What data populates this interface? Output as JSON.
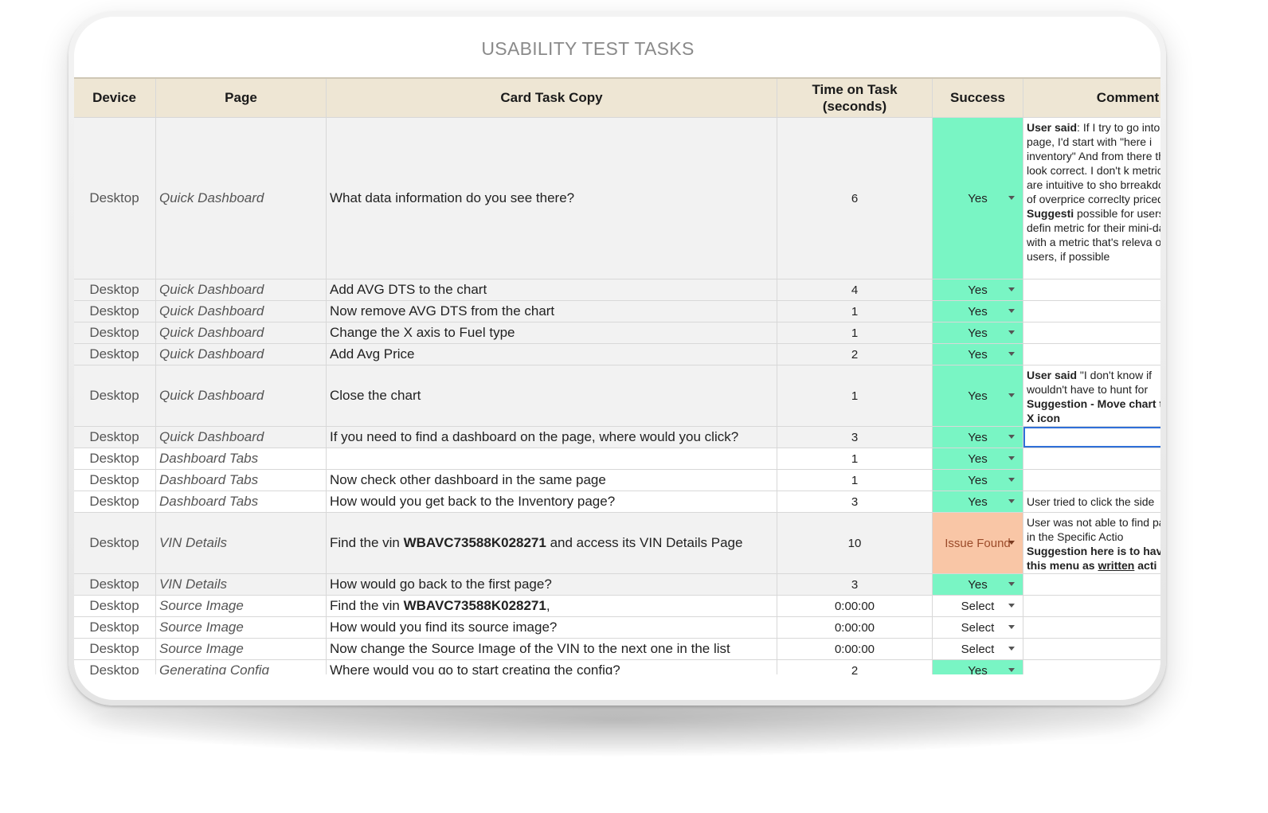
{
  "title": "USABILITY TEST TASKS",
  "columns": {
    "device": "Device",
    "page": "Page",
    "task": "Card Task Copy",
    "time": "Time on Task (seconds)",
    "success": "Success",
    "comments": "Comment"
  },
  "rows": [
    {
      "device": "Desktop",
      "page": "Quick Dashboard",
      "task": "What data information do you see there?",
      "time": "6",
      "success": "Yes",
      "comment_html": "<b>User said</b>: If I try to go into page, I'd start with \"here i inventory\"  And from there they look correct. I don't k metrics are intuitive to sho brreakdowns of overprice correclty priced. <b>Suggesti</b> possible for users to defin metric for their mini-dashb with a metric that's releva of users, if possible"
    },
    {
      "device": "Desktop",
      "page": "Quick Dashboard",
      "task": "Add AVG DTS to the chart",
      "time": "4",
      "success": "Yes",
      "comment_html": ""
    },
    {
      "device": "Desktop",
      "page": "Quick Dashboard",
      "task": "Now remove AVG DTS from the chart",
      "time": "1",
      "success": "Yes",
      "comment_html": ""
    },
    {
      "device": "Desktop",
      "page": "Quick Dashboard",
      "task": "Change the X axis to Fuel type",
      "time": "1",
      "success": "Yes",
      "comment_html": ""
    },
    {
      "device": "Desktop",
      "page": "Quick Dashboard",
      "task": "Add Avg Price",
      "time": "2",
      "success": "Yes",
      "comment_html": ""
    },
    {
      "device": "Desktop",
      "page": "Quick Dashboard",
      "task": "Close the chart",
      "time": "1",
      "success": "Yes",
      "comment_html": "<b>User said</b> \"I don't know if wouldn't have to hunt for <b>Suggestion - Move chart the X icon</b>"
    },
    {
      "device": "Desktop",
      "page": "Quick Dashboard",
      "task": "If you need to find a dashboard on the page, where would you click?",
      "time": "3",
      "success": "Yes",
      "comment_html": ""
    },
    {
      "device": "Desktop",
      "page": "Dashboard Tabs",
      "task": "",
      "time": "1",
      "success": "Yes",
      "comment_html": ""
    },
    {
      "device": "Desktop",
      "page": "Dashboard Tabs",
      "task": "Now check other dashboard in the same page",
      "time": "1",
      "success": "Yes",
      "comment_html": ""
    },
    {
      "device": "Desktop",
      "page": "Dashboard Tabs",
      "task": "How would you get back to the Inventory page?",
      "time": "3",
      "success": "Yes",
      "comment_html": "User tried to click the side"
    },
    {
      "device": "Desktop",
      "page": "VIN Details",
      "task_html": "Find the vin <b>WBAVC73588K028271</b> and access its VIN Details Page",
      "time": "10",
      "success": "Issue Found",
      "comment_html": "User was not able to find page in the Specific Actio <b>Suggestion here is to hav this menu as <u>written</u> acti</b>"
    },
    {
      "device": "Desktop",
      "page": "VIN Details",
      "task": "How would go back to the first page?",
      "time": "3",
      "success": "Yes",
      "comment_html": ""
    },
    {
      "device": "Desktop",
      "page": "Source Image",
      "task_html": "Find the vin <b>WBAVC73588K028271</b>,",
      "time": "0:00:00",
      "success": "Select",
      "comment_html": ""
    },
    {
      "device": "Desktop",
      "page": "Source Image",
      "task": "How would you find its source image?",
      "time": "0:00:00",
      "success": "Select",
      "comment_html": ""
    },
    {
      "device": "Desktop",
      "page": "Source Image",
      "task": "Now change the Source Image of the VIN to the next one in the list",
      "time": "0:00:00",
      "success": "Select",
      "comment_html": ""
    },
    {
      "device": "Desktop",
      "page": "Generating Config",
      "task": "Where would you go to start creating the config?",
      "time": "2",
      "success": "Yes",
      "comment_html": ""
    }
  ],
  "colors": {
    "header_bg": "#eee6d4",
    "yes_bg": "#79f5c4",
    "issue_bg": "#f9c6a6",
    "selection": "#2f6fd8"
  }
}
